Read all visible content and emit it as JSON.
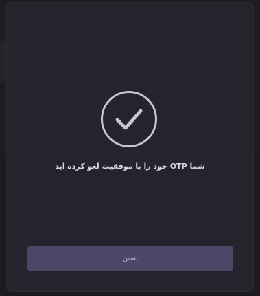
{
  "dialog": {
    "icon": "check-circle-icon",
    "message": "شما OTP خود را با موفقیت لغو کرده اید",
    "close_label": "بستن"
  },
  "colors": {
    "modal_background": "#25242c",
    "icon": "#c8c4d6",
    "button_background": "#4b4766",
    "button_text": "#b8b4c8"
  }
}
